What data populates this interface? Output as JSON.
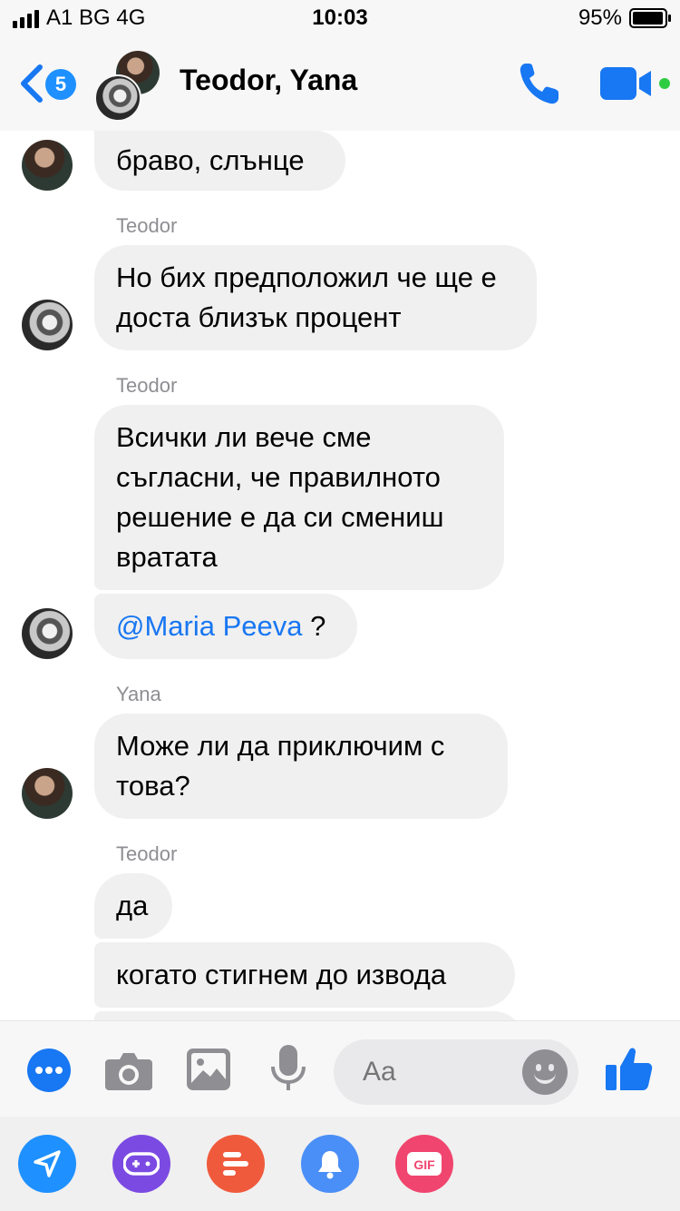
{
  "status_bar": {
    "carrier": "A1 BG",
    "network": "4G",
    "time": "10:03",
    "battery": "95%"
  },
  "header": {
    "back_badge": "5",
    "title": "Teodor, Yana"
  },
  "messages": [
    {
      "sender": "",
      "text": "браво, слънце",
      "avatar": "yana"
    },
    {
      "sender": "Teodor",
      "text": "Но бих предположил че ще е доста близък процент",
      "avatar": "teodor"
    },
    {
      "sender": "Teodor",
      "text": "Всички ли вече сме съгласни, че правилното решение е да си смениш вратата",
      "avatar": ""
    },
    {
      "sender": "",
      "mention": "@Maria Peeva",
      "text": " ?",
      "avatar": "teodor"
    },
    {
      "sender": "Yana",
      "text": "Може ли да приключим с това?",
      "avatar": "yana"
    },
    {
      "sender": "Teodor",
      "text": "да",
      "avatar": ""
    },
    {
      "sender": "",
      "text": "когато стигнем до извода",
      "avatar": ""
    }
  ],
  "composer": {
    "placeholder": "Aa"
  },
  "colors": {
    "accent": "#1877f2",
    "bubble": "#f0f0f0",
    "online": "#2ecc40"
  },
  "app_icons": [
    "send-icon",
    "game-controller-icon",
    "polls-icon",
    "bell-icon",
    "gif-icon"
  ]
}
